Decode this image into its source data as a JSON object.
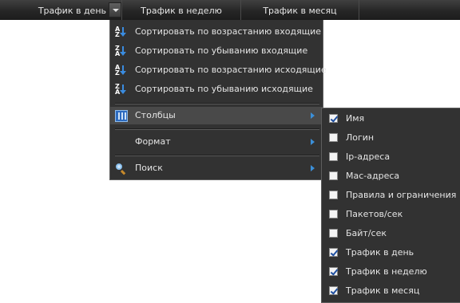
{
  "header": {
    "columns": [
      "Трафик в день",
      "Трафик в неделю",
      "Трафик в месяц"
    ],
    "dropdown_icon": "chevron-down-icon"
  },
  "context_menu": {
    "sort_items": [
      {
        "label": "Сортировать по возрастанию входящие",
        "icon": "sort-ascending-icon"
      },
      {
        "label": "Сортировать по убыванию входящие",
        "icon": "sort-descending-icon"
      },
      {
        "label": "Сортировать по возрастанию исходящие",
        "icon": "sort-ascending-icon"
      },
      {
        "label": "Сортировать по убыванию исходящие",
        "icon": "sort-descending-icon"
      }
    ],
    "columns_label": "Столбцы",
    "format_label": "Формат",
    "search_label": "Поиск"
  },
  "columns_submenu": {
    "items": [
      {
        "label": "Имя",
        "checked": true
      },
      {
        "label": "Логин",
        "checked": false
      },
      {
        "label": "Ip-адреса",
        "checked": false
      },
      {
        "label": "Mac-адреса",
        "checked": false
      },
      {
        "label": "Правила и ограничения",
        "checked": false
      },
      {
        "label": "Пакетов/сек",
        "checked": false
      },
      {
        "label": "Байт/сек",
        "checked": false
      },
      {
        "label": "Трафик в день",
        "checked": true
      },
      {
        "label": "Трафик в неделю",
        "checked": true
      },
      {
        "label": "Трафик в месяц",
        "checked": true
      }
    ]
  },
  "colors": {
    "menu_bg": "#323232",
    "highlight": "#494949",
    "accent": "#3b8fd8",
    "text": "#e4e4e4"
  }
}
